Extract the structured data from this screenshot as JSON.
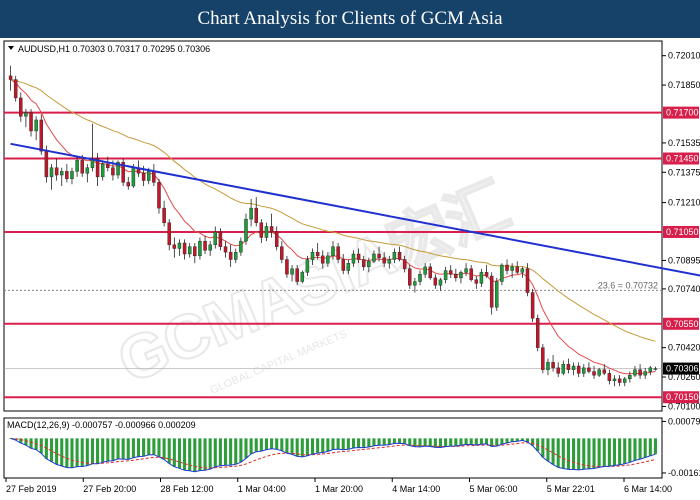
{
  "banner": {
    "title": "Chart Analysis for Clients of GCM Asia"
  },
  "watermark": {
    "main": "GCMASIA宏汇",
    "sub": "GLOBAL CAPITAL MARKETS"
  },
  "colors": {
    "banner_bg": "#16426a",
    "bull": "#1f9c3a",
    "bear": "#c0172b",
    "support_resistance": "#d81e4a",
    "trendline": "#1f2fd0",
    "ma_fast": "#e24a4a",
    "ma_slow": "#c79a3a",
    "macd_line": "#1f3bd0",
    "signal_line": "#e02a2a",
    "hist": "#2d9c3a"
  },
  "chart_data": {
    "type": "candlestick",
    "symbol_info": "AUDUSD,H1  0.70303 0.70317 0.70295 0.70306",
    "y_ticks": [
      0.7201,
      0.7185,
      0.71535,
      0.71375,
      0.7121,
      0.70895,
      0.7074,
      0.7042,
      0.7026,
      0.701
    ],
    "ylim": [
      0.70075,
      0.7209
    ],
    "x_ticks": [
      "27 Feb 2019",
      "27 Feb 20:00",
      "28 Feb 12:00",
      "1 Mar 04:00",
      "1 Mar 20:00",
      "4 Mar 14:00",
      "5 Mar 06:00",
      "5 Mar 22:01",
      "6 Mar 14:00"
    ],
    "horizontal_levels": [
      {
        "value": 0.717,
        "label": "0.71700"
      },
      {
        "value": 0.7145,
        "label": "0.71450"
      },
      {
        "value": 0.7105,
        "label": "0.71050"
      },
      {
        "value": 0.7055,
        "label": "0.70550"
      },
      {
        "value": 0.7015,
        "label": "0.70150"
      }
    ],
    "fibo": {
      "value": 0.70732,
      "label": "23.6 = 0.70732"
    },
    "current_price": {
      "value": 0.70306,
      "label": "0.70306"
    },
    "trendline": {
      "from": [
        0,
        0.7153
      ],
      "to": [
        139,
        0.7079
      ]
    },
    "candles": [
      [
        0.719,
        0.71955,
        0.7182,
        0.7188
      ],
      [
        0.7188,
        0.719,
        0.7176,
        0.7178
      ],
      [
        0.7178,
        0.7181,
        0.7165,
        0.7168
      ],
      [
        0.7168,
        0.7172,
        0.7162,
        0.717
      ],
      [
        0.717,
        0.7172,
        0.7157,
        0.716
      ],
      [
        0.716,
        0.7168,
        0.7155,
        0.7166
      ],
      [
        0.7166,
        0.7169,
        0.7147,
        0.7149
      ],
      [
        0.7149,
        0.7152,
        0.7132,
        0.7135
      ],
      [
        0.7135,
        0.7142,
        0.7128,
        0.714
      ],
      [
        0.714,
        0.7145,
        0.7133,
        0.7136
      ],
      [
        0.7136,
        0.714,
        0.713,
        0.7138
      ],
      [
        0.7138,
        0.7142,
        0.7132,
        0.7134
      ],
      [
        0.7134,
        0.714,
        0.7131,
        0.7138
      ],
      [
        0.7138,
        0.7146,
        0.7135,
        0.7144
      ],
      [
        0.7144,
        0.7147,
        0.7135,
        0.7137
      ],
      [
        0.7137,
        0.7142,
        0.7132,
        0.714
      ],
      [
        0.714,
        0.7164,
        0.7138,
        0.7145
      ],
      [
        0.7145,
        0.7148,
        0.713,
        0.7135
      ],
      [
        0.7135,
        0.7144,
        0.7133,
        0.7142
      ],
      [
        0.7142,
        0.7146,
        0.7138,
        0.714
      ],
      [
        0.714,
        0.7144,
        0.7133,
        0.7136
      ],
      [
        0.7136,
        0.7144,
        0.7134,
        0.7143
      ],
      [
        0.7143,
        0.7145,
        0.713,
        0.7132
      ],
      [
        0.7132,
        0.7135,
        0.7128,
        0.713
      ],
      [
        0.713,
        0.7142,
        0.7129,
        0.714
      ],
      [
        0.714,
        0.7144,
        0.7135,
        0.7137
      ],
      [
        0.7137,
        0.7141,
        0.713,
        0.7133
      ],
      [
        0.7133,
        0.714,
        0.7131,
        0.7138
      ],
      [
        0.7138,
        0.7142,
        0.713,
        0.7132
      ],
      [
        0.7132,
        0.7134,
        0.7115,
        0.7118
      ],
      [
        0.7118,
        0.7122,
        0.7108,
        0.711
      ],
      [
        0.711,
        0.7112,
        0.7095,
        0.7098
      ],
      [
        0.7098,
        0.7102,
        0.7091,
        0.7096
      ],
      [
        0.7096,
        0.7101,
        0.7092,
        0.7099
      ],
      [
        0.7099,
        0.7101,
        0.709,
        0.7093
      ],
      [
        0.7093,
        0.7099,
        0.7091,
        0.7097
      ],
      [
        0.7097,
        0.7099,
        0.7088,
        0.7092
      ],
      [
        0.7092,
        0.7102,
        0.709,
        0.71
      ],
      [
        0.71,
        0.7103,
        0.7093,
        0.7095
      ],
      [
        0.7095,
        0.71,
        0.7092,
        0.7098
      ],
      [
        0.7098,
        0.7108,
        0.7096,
        0.7105
      ],
      [
        0.7105,
        0.7107,
        0.7095,
        0.7097
      ],
      [
        0.7097,
        0.71,
        0.7091,
        0.7094
      ],
      [
        0.7094,
        0.7098,
        0.7086,
        0.709
      ],
      [
        0.709,
        0.7096,
        0.7088,
        0.7094
      ],
      [
        0.7094,
        0.7102,
        0.7092,
        0.71
      ],
      [
        0.71,
        0.7115,
        0.7098,
        0.7112
      ],
      [
        0.7112,
        0.7123,
        0.7108,
        0.7118
      ],
      [
        0.7118,
        0.7124,
        0.7108,
        0.711
      ],
      [
        0.711,
        0.7112,
        0.7099,
        0.7102
      ],
      [
        0.7102,
        0.711,
        0.71,
        0.7108
      ],
      [
        0.7108,
        0.7115,
        0.7102,
        0.7105
      ],
      [
        0.7105,
        0.7108,
        0.7095,
        0.7097
      ],
      [
        0.7097,
        0.71,
        0.7088,
        0.709
      ],
      [
        0.709,
        0.7092,
        0.708,
        0.7082
      ],
      [
        0.7082,
        0.7087,
        0.7078,
        0.7085
      ],
      [
        0.7085,
        0.7087,
        0.7076,
        0.7078
      ],
      [
        0.7078,
        0.7084,
        0.7077,
        0.7083
      ],
      [
        0.7083,
        0.7092,
        0.7081,
        0.709
      ],
      [
        0.709,
        0.7096,
        0.7087,
        0.7094
      ],
      [
        0.7094,
        0.7099,
        0.709,
        0.7092
      ],
      [
        0.7092,
        0.7095,
        0.7085,
        0.7088
      ],
      [
        0.7088,
        0.7094,
        0.7086,
        0.7092
      ],
      [
        0.7092,
        0.71,
        0.709,
        0.7097
      ],
      [
        0.7097,
        0.7099,
        0.7088,
        0.709
      ],
      [
        0.709,
        0.7093,
        0.7082,
        0.7084
      ],
      [
        0.7084,
        0.709,
        0.7082,
        0.7088
      ],
      [
        0.7088,
        0.7095,
        0.7086,
        0.7093
      ],
      [
        0.7093,
        0.7096,
        0.7088,
        0.709
      ],
      [
        0.709,
        0.7092,
        0.7084,
        0.7086
      ],
      [
        0.7086,
        0.7091,
        0.7083,
        0.7089
      ],
      [
        0.7089,
        0.7095,
        0.7088,
        0.7093
      ],
      [
        0.7093,
        0.7097,
        0.7089,
        0.7091
      ],
      [
        0.7091,
        0.7094,
        0.7086,
        0.7088
      ],
      [
        0.7088,
        0.7092,
        0.7085,
        0.709
      ],
      [
        0.709,
        0.7096,
        0.7088,
        0.7094
      ],
      [
        0.7094,
        0.7097,
        0.7089,
        0.709
      ],
      [
        0.709,
        0.7092,
        0.7083,
        0.7085
      ],
      [
        0.7085,
        0.7087,
        0.7074,
        0.7076
      ],
      [
        0.7076,
        0.708,
        0.7072,
        0.7078
      ],
      [
        0.7078,
        0.7084,
        0.7076,
        0.7082
      ],
      [
        0.7082,
        0.7088,
        0.708,
        0.7086
      ],
      [
        0.7086,
        0.7088,
        0.7079,
        0.708
      ],
      [
        0.708,
        0.7082,
        0.7074,
        0.7076
      ],
      [
        0.7076,
        0.708,
        0.7073,
        0.7079
      ],
      [
        0.7079,
        0.7086,
        0.7077,
        0.7084
      ],
      [
        0.7084,
        0.7087,
        0.708,
        0.7082
      ],
      [
        0.7082,
        0.7085,
        0.7078,
        0.708
      ],
      [
        0.708,
        0.7084,
        0.7077,
        0.7083
      ],
      [
        0.7083,
        0.7088,
        0.7081,
        0.7085
      ],
      [
        0.7085,
        0.7087,
        0.7078,
        0.7079
      ],
      [
        0.7079,
        0.7081,
        0.7074,
        0.7077
      ],
      [
        0.7077,
        0.7085,
        0.7075,
        0.7083
      ],
      [
        0.7083,
        0.7087,
        0.708,
        0.7081
      ],
      [
        0.7081,
        0.7083,
        0.706,
        0.7064
      ],
      [
        0.7064,
        0.708,
        0.7062,
        0.7078
      ],
      [
        0.7078,
        0.7088,
        0.7076,
        0.7087
      ],
      [
        0.7087,
        0.709,
        0.7082,
        0.7084
      ],
      [
        0.7084,
        0.7088,
        0.708,
        0.7086
      ],
      [
        0.7086,
        0.7089,
        0.7082,
        0.7083
      ],
      [
        0.7083,
        0.7086,
        0.708,
        0.7085
      ],
      [
        0.7085,
        0.7088,
        0.707,
        0.7072
      ],
      [
        0.7072,
        0.7074,
        0.7056,
        0.7058
      ],
      [
        0.7058,
        0.706,
        0.704,
        0.7042
      ],
      [
        0.7042,
        0.7044,
        0.7028,
        0.703
      ],
      [
        0.703,
        0.7036,
        0.7027,
        0.7034
      ],
      [
        0.7034,
        0.7038,
        0.7029,
        0.7031
      ],
      [
        0.7031,
        0.7034,
        0.7026,
        0.7028
      ],
      [
        0.7028,
        0.7035,
        0.7027,
        0.7033
      ],
      [
        0.7033,
        0.7036,
        0.7028,
        0.703
      ],
      [
        0.703,
        0.7034,
        0.7027,
        0.7032
      ],
      [
        0.7032,
        0.7034,
        0.7026,
        0.7028
      ],
      [
        0.7028,
        0.7033,
        0.7026,
        0.7031
      ],
      [
        0.7031,
        0.7034,
        0.7028,
        0.7029
      ],
      [
        0.7029,
        0.7032,
        0.7025,
        0.7027
      ],
      [
        0.7027,
        0.7031,
        0.7026,
        0.703
      ],
      [
        0.703,
        0.7033,
        0.7027,
        0.7028
      ],
      [
        0.7028,
        0.703,
        0.7022,
        0.7024
      ],
      [
        0.7024,
        0.7027,
        0.7021,
        0.7025
      ],
      [
        0.7025,
        0.7027,
        0.7021,
        0.7023
      ],
      [
        0.7023,
        0.7026,
        0.7021,
        0.7025
      ],
      [
        0.7025,
        0.7029,
        0.7023,
        0.7027
      ],
      [
        0.7027,
        0.7032,
        0.7026,
        0.703
      ],
      [
        0.703,
        0.7033,
        0.7025,
        0.7027
      ],
      [
        0.7027,
        0.7031,
        0.7025,
        0.7029
      ],
      [
        0.7029,
        0.7032,
        0.7027,
        0.7031
      ],
      [
        0.70303,
        0.70317,
        0.70295,
        0.70306
      ]
    ],
    "macd": {
      "label": "MACD(12,26,9) -0.000757 -0.000966 0.000209",
      "y_ticks": [
        0.00079,
        -0.001615
      ],
      "ylim": [
        -0.00185,
        0.00095
      ]
    }
  }
}
